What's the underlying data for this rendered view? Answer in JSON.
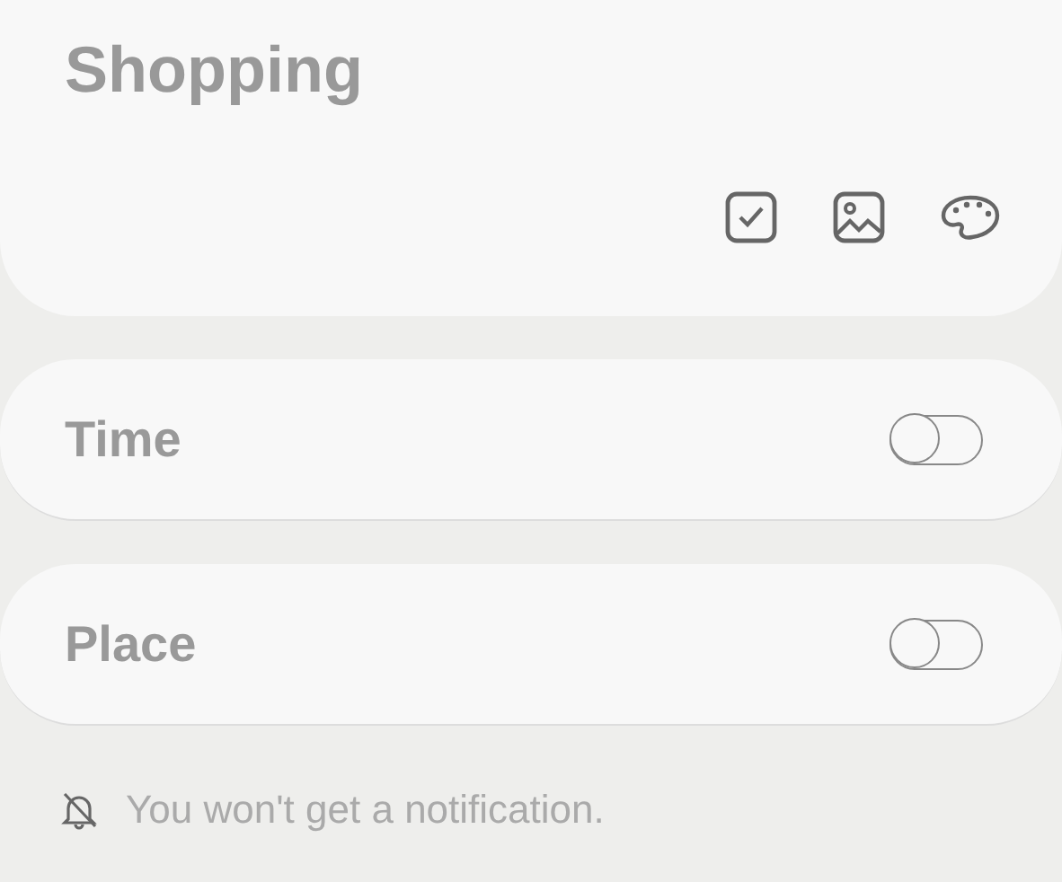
{
  "note": {
    "title": "Shopping"
  },
  "toolbar": [
    {
      "kind": "checklist"
    },
    {
      "kind": "image"
    },
    {
      "kind": "palette"
    }
  ],
  "reminders": [
    {
      "label": "Time",
      "on": false
    },
    {
      "label": "Place",
      "on": false
    }
  ],
  "notification": {
    "text": "You won't get a notification."
  }
}
